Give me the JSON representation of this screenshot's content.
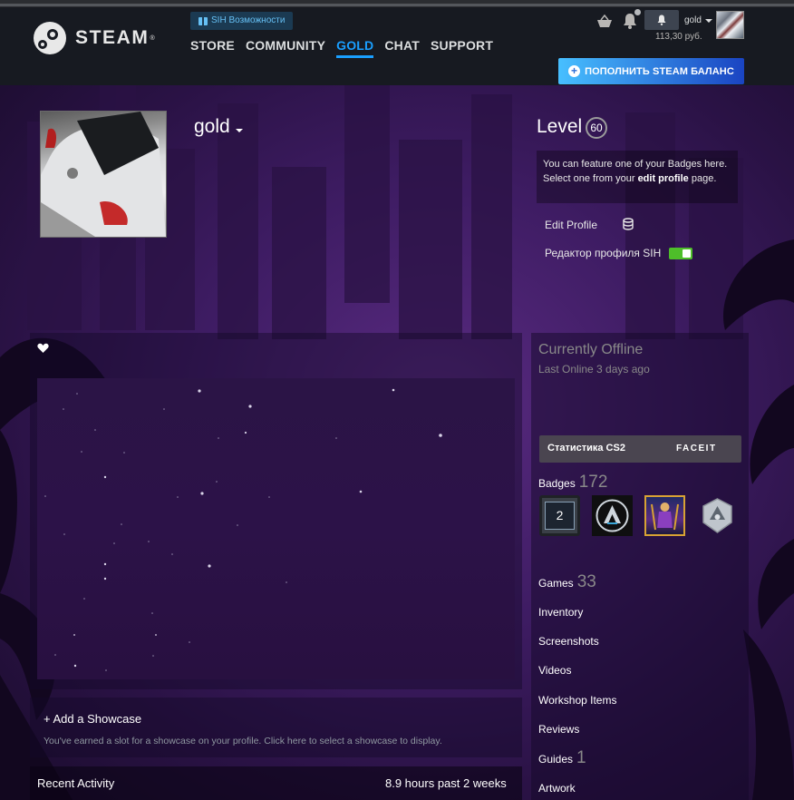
{
  "header": {
    "sih_feature_label": "SIH Возможности",
    "nav": [
      "STORE",
      "COMMUNITY",
      "GOLD",
      "CHAT",
      "SUPPORT"
    ],
    "active_nav": "GOLD",
    "account_name": "gold",
    "wallet_balance": "113,30 руб.",
    "add_funds_label": "ПОПОЛНИТЬ STEAM БАЛАНС",
    "logo_text": "STEAM"
  },
  "profile": {
    "persona_name": "gold",
    "level_label": "Level",
    "level_value": "60",
    "feature_badge_text_1": "You can feature one of your Badges here.",
    "feature_badge_text_2": "Select one from your ",
    "feature_badge_link": "edit profile",
    "feature_badge_text_3": " page.",
    "edit_profile_label": "Edit Profile",
    "sih_editor_label": "Редактор профиля SIH",
    "sih_editor_enabled": true
  },
  "showcase": {
    "title": "+ Add a Showcase",
    "description": "You've earned a slot for a showcase on your profile. Click here to select a showcase to display."
  },
  "activity": {
    "title": "Recent Activity",
    "hours": "8.9 hours past 2 weeks"
  },
  "status": {
    "title": "Currently Offline",
    "last_online": "Last Online 3 days ago"
  },
  "cs2": {
    "label": "Статистика CS2",
    "provider": "FACEIT"
  },
  "counts": {
    "badges_label": "Badges",
    "badges_value": "172",
    "games_label": "Games",
    "games_value": "33",
    "guides_label": "Guides",
    "guides_value": "1"
  },
  "badges": [
    {
      "name": "years-of-service",
      "text": "2"
    },
    {
      "name": "cs2-service-medal",
      "text": ""
    },
    {
      "name": "artwork-badge",
      "text": ""
    },
    {
      "name": "silver-badge",
      "text": ""
    }
  ],
  "links": [
    "Inventory",
    "Screenshots",
    "Videos",
    "Workshop Items",
    "Reviews",
    "Artwork"
  ],
  "colors": {
    "accent": "#1a9fff",
    "add_funds_start": "#47bfff",
    "add_funds_end": "#1a44c2",
    "toggle_on": "#4ebe2a",
    "background_purple": "#3e1c63"
  }
}
